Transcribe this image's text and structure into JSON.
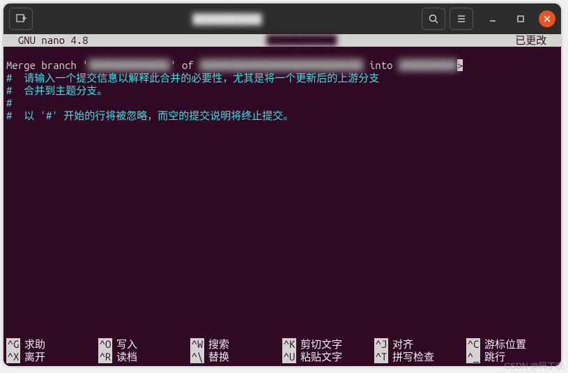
{
  "titlebar": {
    "title_obscured": "██████████"
  },
  "nano": {
    "app": "  GNU nano 4.8",
    "file_obscured": "████████████",
    "status": "已更改  "
  },
  "editor": {
    "merge_prefix": "Merge branch '",
    "merge_mid": "' of ",
    "merge_suffix_a": " into ",
    "line2": "#  请输入一个提交信息以解释此合并的必要性，尤其是将一个更新后的上游分支",
    "line3": "#  合并到主题分支。",
    "line4": "#",
    "line5": "#  以 '#' 开始的行将被忽略，而空的提交说明将终止提交。"
  },
  "shortcuts": {
    "row1": [
      {
        "key": "^G",
        "label": "求助"
      },
      {
        "key": "^O",
        "label": "写入"
      },
      {
        "key": "^W",
        "label": "搜索"
      },
      {
        "key": "^K",
        "label": "剪切文字"
      },
      {
        "key": "^J",
        "label": "对齐"
      },
      {
        "key": "^C",
        "label": "游标位置"
      }
    ],
    "row2": [
      {
        "key": "^X",
        "label": "离开"
      },
      {
        "key": "^R",
        "label": "读档"
      },
      {
        "key": "^\\",
        "label": "替换"
      },
      {
        "key": "^U",
        "label": "粘贴文字"
      },
      {
        "key": "^T",
        "label": "拼写检查"
      },
      {
        "key": "^_",
        "label": "跳行"
      }
    ]
  },
  "watermark": "CSDN @码丁农"
}
